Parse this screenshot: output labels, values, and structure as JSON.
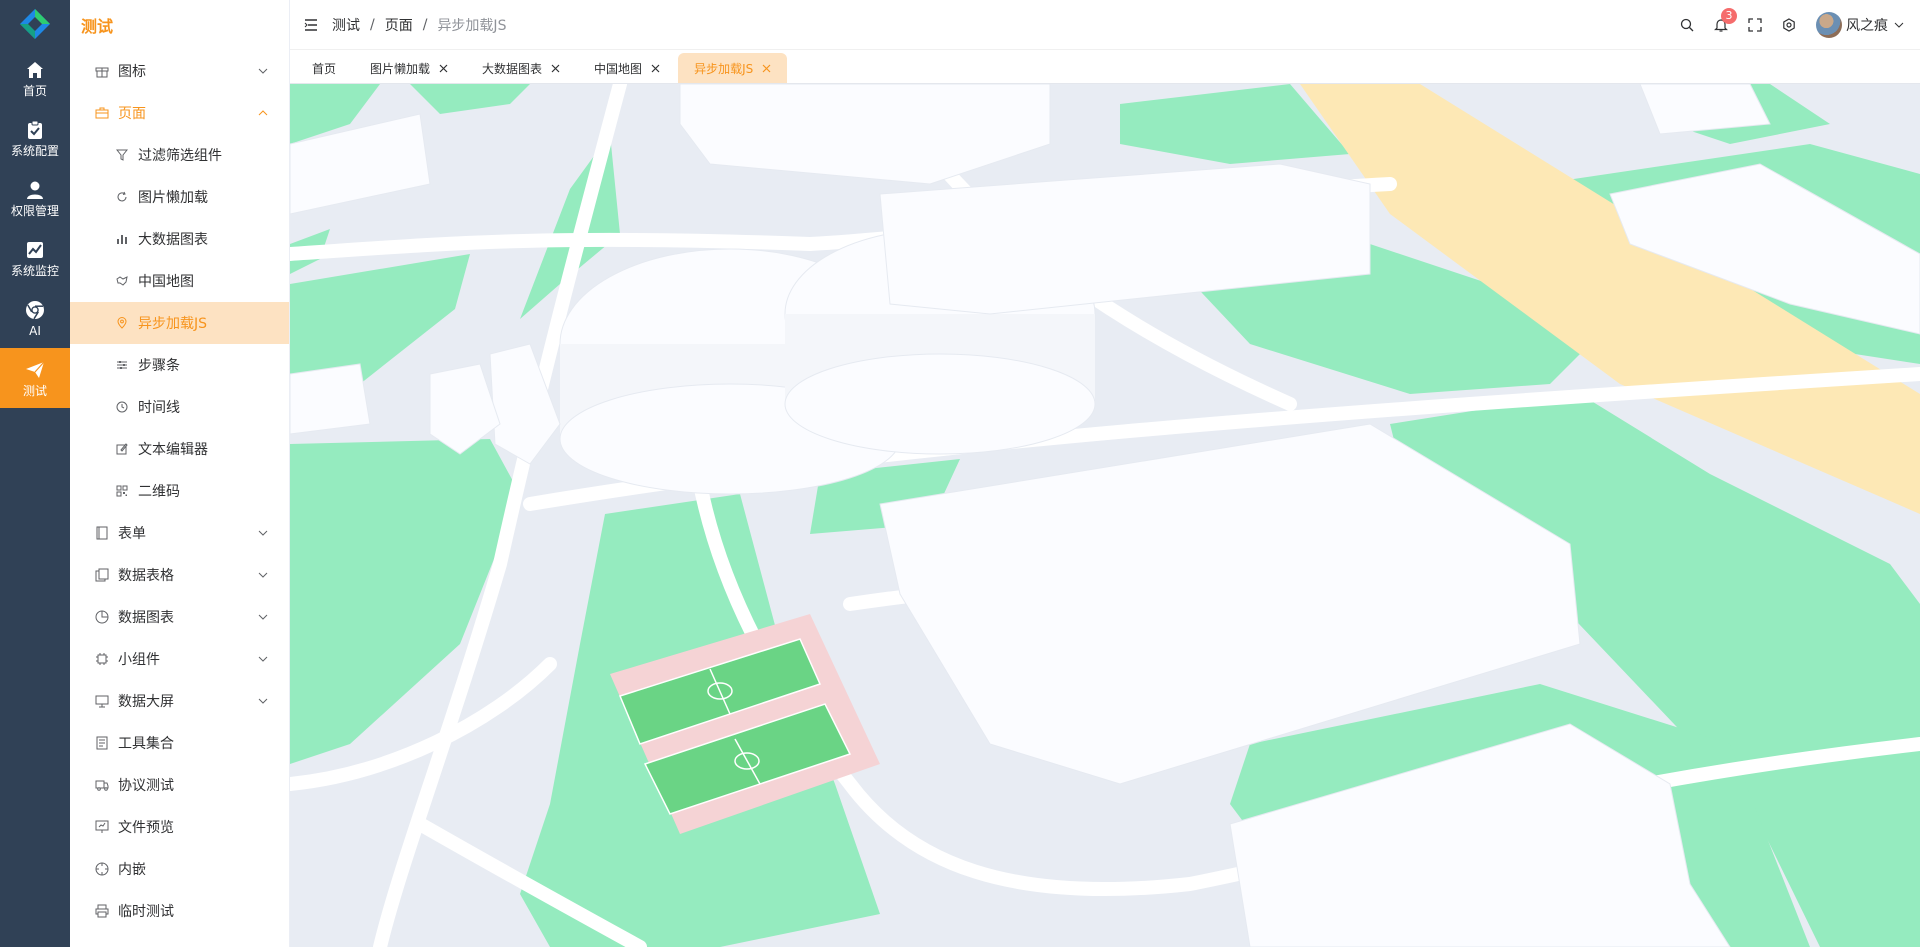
{
  "rail": [
    {
      "label": "首页",
      "icon": "home-icon"
    },
    {
      "label": "系统配置",
      "icon": "clipboard-icon"
    },
    {
      "label": "权限管理",
      "icon": "user-icon"
    },
    {
      "label": "系统监控",
      "icon": "chart-line-icon"
    },
    {
      "label": "AI",
      "icon": "chrome-icon"
    },
    {
      "label": "测试",
      "icon": "send-icon"
    }
  ],
  "menu": {
    "title": "测试",
    "items": [
      {
        "label": "图标"
      },
      {
        "label": "页面"
      },
      {
        "label": "过滤筛选组件"
      },
      {
        "label": "图片懒加载"
      },
      {
        "label": "大数据图表"
      },
      {
        "label": "中国地图"
      },
      {
        "label": "异步加载JS"
      },
      {
        "label": "步骤条"
      },
      {
        "label": "时间线"
      },
      {
        "label": "文本编辑器"
      },
      {
        "label": "二维码"
      },
      {
        "label": "表单"
      },
      {
        "label": "数据表格"
      },
      {
        "label": "数据图表"
      },
      {
        "label": "小组件"
      },
      {
        "label": "数据大屏"
      },
      {
        "label": "工具集合"
      },
      {
        "label": "协议测试"
      },
      {
        "label": "文件预览"
      },
      {
        "label": "内嵌"
      },
      {
        "label": "临时测试"
      }
    ]
  },
  "header": {
    "breadcrumb": [
      "测试",
      "页面",
      "异步加载JS"
    ],
    "sep": "/",
    "notification_count": "3",
    "username": "风之痕"
  },
  "tabs": [
    {
      "label": "首页"
    },
    {
      "label": "图片懒加载"
    },
    {
      "label": "大数据图表"
    },
    {
      "label": "中国地图"
    },
    {
      "label": "异步加载JS"
    }
  ],
  "colors": {
    "accent": "#f7941d",
    "rail_bg": "#304156",
    "active_bg": "#fde2c2",
    "map_green": "#95ebbf",
    "map_road": "#ffffff",
    "map_highway": "#fde8b5"
  }
}
